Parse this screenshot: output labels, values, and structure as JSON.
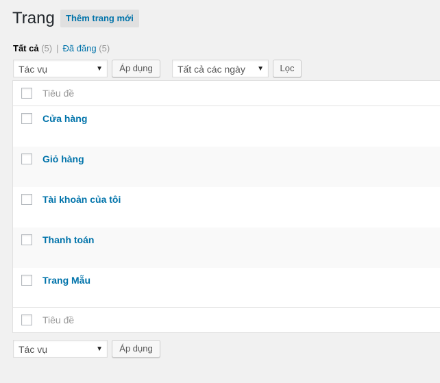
{
  "header": {
    "title": "Trang",
    "add_new_label": "Thêm trang mới"
  },
  "filters": {
    "all_label": "Tất cả",
    "all_count": "(5)",
    "separator": "|",
    "published_label": "Đã đăng",
    "published_count": "(5)"
  },
  "bulk_top": {
    "action_select": "Tác vụ",
    "apply_label": "Áp dụng",
    "date_select": "Tất cả các ngày",
    "filter_label": "Lọc"
  },
  "table": {
    "header_title": "Tiêu đề",
    "footer_title": "Tiêu đề",
    "rows": [
      {
        "title": "Cửa hàng"
      },
      {
        "title": "Giỏ hàng"
      },
      {
        "title": "Tài khoản của tôi"
      },
      {
        "title": "Thanh toán"
      },
      {
        "title": "Trang Mẫu"
      }
    ]
  },
  "bulk_bottom": {
    "action_select": "Tác vụ",
    "apply_label": "Áp dụng"
  },
  "icons": {
    "dropdown": "chevron-down-icon"
  }
}
